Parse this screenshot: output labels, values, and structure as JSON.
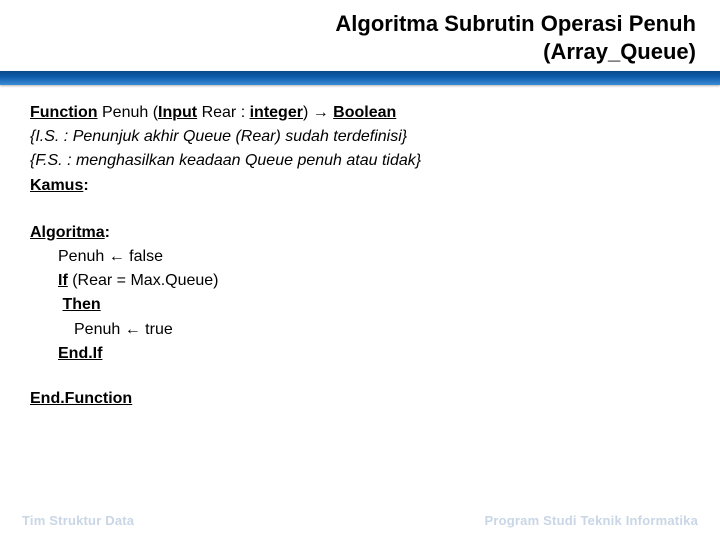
{
  "header": {
    "title_line1": "Algoritma Subrutin Operasi Penuh",
    "title_line2": "(Array_Queue)"
  },
  "sig": {
    "function_kw": "Function",
    "name_space": "  Penuh (",
    "input_kw": "Input",
    "params_text": " Rear : ",
    "type_kw": "integer",
    "close_paren": ")",
    "arrow": " → ",
    "return_kw": "Boolean"
  },
  "states": {
    "is": "{I.S. : Penunjuk akhir Queue (Rear) sudah terdefinisi}",
    "fs": "{F.S. : menghasilkan keadaan Queue penuh atau tidak}"
  },
  "kamus": {
    "label": "Kamus",
    "colon": ":"
  },
  "algoritma": {
    "label": "Algoritma",
    "colon": ":",
    "l1_a": "Penuh ",
    "l1_arrow": "←",
    "l1_b": " false",
    "l2_if": "If",
    "l2_cond": " (Rear = Max.Queue)",
    "l3_then": "Then",
    "l4_a": "Penuh ",
    "l4_arrow": "←",
    "l4_b": " true",
    "l5_endif": "End.If"
  },
  "endfn": "End.Function",
  "footer": {
    "left": "Tim Struktur Data",
    "right": "Program Studi Teknik Informatika"
  }
}
